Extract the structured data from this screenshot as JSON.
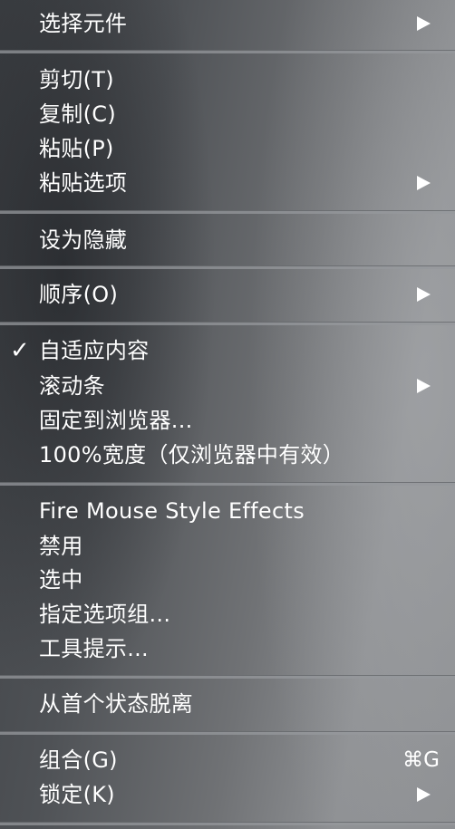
{
  "menu": {
    "items": {
      "select_component": "选择元件",
      "cut": "剪切(T)",
      "copy": "复制(C)",
      "paste": "粘贴(P)",
      "paste_options": "粘贴选项",
      "set_hidden": "设为隐藏",
      "order": "顺序(O)",
      "fit_content": "自适应内容",
      "fit_content_checked": "✓",
      "scrollbar": "滚动条",
      "pin_to_browser": "固定到浏览器...",
      "full_width": "100%宽度（仅浏览器中有效）",
      "fire_mouse_style_effects": "Fire Mouse Style Effects",
      "disable": "禁用",
      "selected": "选中",
      "assign_option_group": "指定选项组...",
      "tooltip": "工具提示...",
      "detach_from_first_state": "从首个状态脱离",
      "group": "组合(G)",
      "group_shortcut": "⌘G",
      "lock": "锁定(K)"
    }
  },
  "colors": {
    "text": "#ffffff",
    "separator": "#96989c"
  }
}
